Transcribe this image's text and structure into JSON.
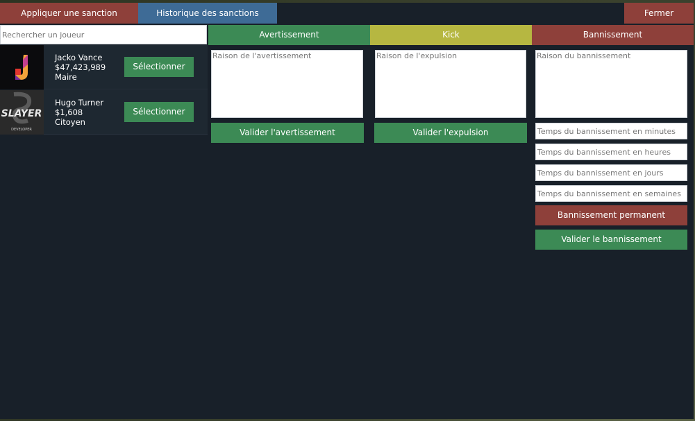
{
  "topbar": {
    "apply_tab": "Appliquer une sanction",
    "history_tab": "Historique des sanctions",
    "close": "Fermer"
  },
  "search": {
    "placeholder": "Rechercher un joueur"
  },
  "players": [
    {
      "name": "Jacko Vance",
      "money": "$47,423,989",
      "job": "Maire",
      "select_label": "Sélectionner",
      "avatar": "jv-logo-icon"
    },
    {
      "name": "Hugo Turner",
      "money": "$1,608",
      "job": "Citoyen",
      "select_label": "Sélectionner",
      "avatar": "slayer-developer-logo",
      "avatar_text": "SLAYER",
      "avatar_sub": "DEVELOPER"
    }
  ],
  "warning": {
    "header": "Avertissement",
    "reason_placeholder": "Raison de l'avertissement",
    "submit": "Valider l'avertissement"
  },
  "kick": {
    "header": "Kick",
    "reason_placeholder": "Raison de l'expulsion",
    "submit": "Valider l'expulsion"
  },
  "ban": {
    "header": "Bannissement",
    "reason_placeholder": "Raison du bannissement",
    "minutes_placeholder": "Temps du bannissement en minutes",
    "hours_placeholder": "Temps du bannissement en heures",
    "days_placeholder": "Temps du bannissement en jours",
    "weeks_placeholder": "Temps du bannissement en semaines",
    "permanent": "Bannissement permanent",
    "submit": "Valider le bannissement"
  },
  "colors": {
    "panel": "#182029",
    "red": "#8e403a",
    "blue": "#3e6b96",
    "green": "#3c8a55",
    "yellow": "#b6b741"
  }
}
